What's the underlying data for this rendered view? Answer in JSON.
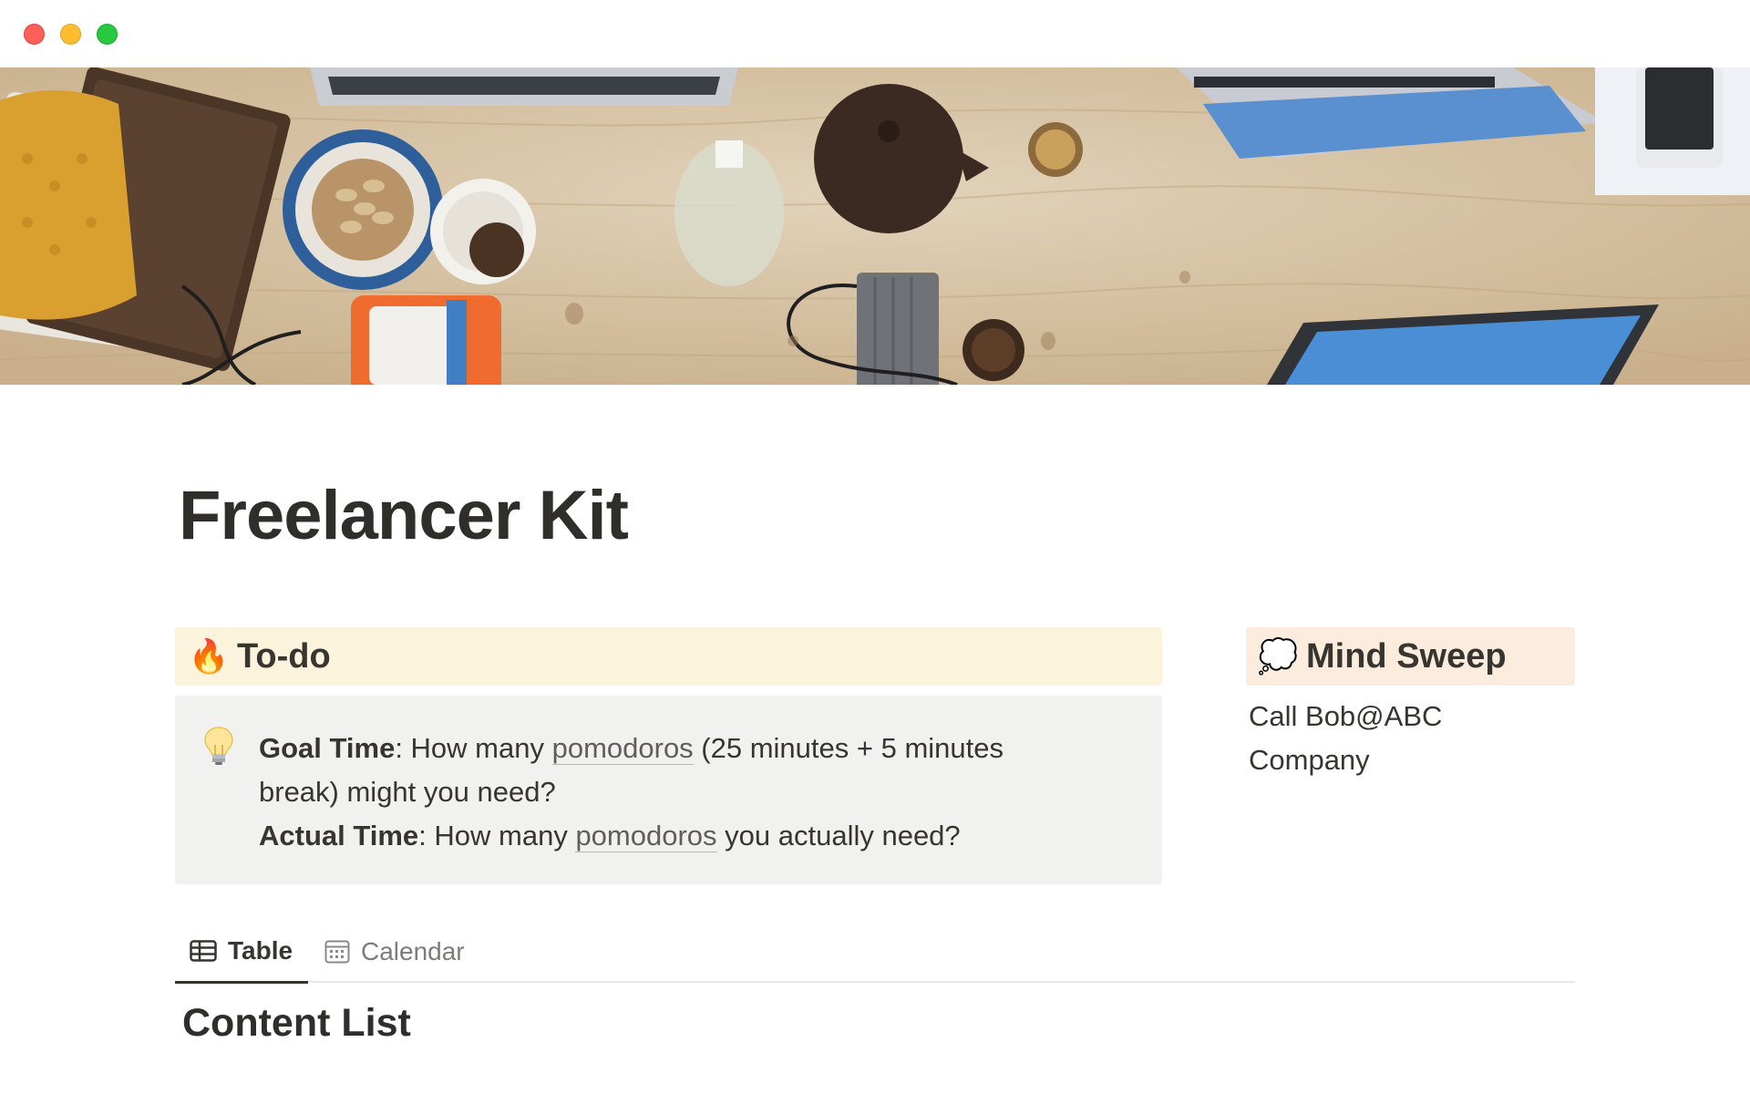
{
  "window": {
    "controls": [
      "close",
      "minimize",
      "zoom"
    ]
  },
  "cover": {
    "description_icon": "desk-photo-cover"
  },
  "page": {
    "title": "Freelancer Kit"
  },
  "todo": {
    "emoji": "🔥",
    "heading": "To-do",
    "heading_color": "#fbf3db",
    "callout": {
      "emoji_icon": "lightbulb-icon",
      "goal_label": "Goal Time",
      "goal_text_pre": ": How many ",
      "goal_link": "pomodoros",
      "goal_text_post": " (25 minutes + 5 minutes break) might you need?",
      "actual_label": "Actual Time",
      "actual_text_pre": ": How many ",
      "actual_link": "pomodoros",
      "actual_text_post": " you actually need?"
    }
  },
  "mind_sweep": {
    "emoji": "💭",
    "heading": "Mind Sweep",
    "heading_color": "#fbecdd",
    "text": "Call Bob@ABC Company"
  },
  "views": {
    "tabs": [
      {
        "label": "Table",
        "icon": "table-icon",
        "active": true
      },
      {
        "label": "Calendar",
        "icon": "calendar-icon",
        "active": false
      }
    ]
  },
  "database": {
    "title": "Content List"
  }
}
